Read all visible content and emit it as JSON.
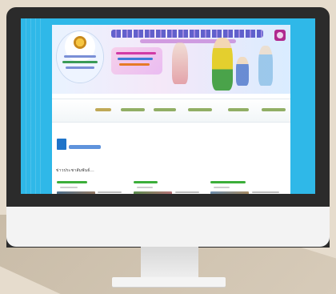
{
  "screen_site": {
    "section_title": "ข่าวประชาสัมพันธ์...",
    "colors": {
      "desk": "#e6dccd",
      "monitor_bezel": "#2b2b2b",
      "screen_background": "#2fb8e8",
      "accent_green": "#3cae3a"
    },
    "icons": [
      "school-emblem-icon",
      "widget-logo-icon",
      "badge-icon"
    ]
  }
}
